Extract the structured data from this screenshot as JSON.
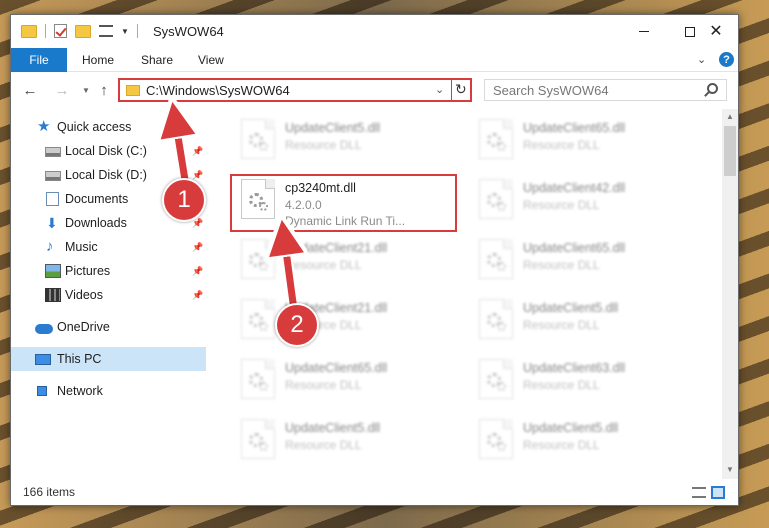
{
  "window": {
    "title": "SysWOW64"
  },
  "ribbon": {
    "tabs": [
      "File",
      "Home",
      "Share",
      "View"
    ]
  },
  "address": {
    "path": "C:\\Windows\\SysWOW64"
  },
  "search": {
    "placeholder": "Search SysWOW64"
  },
  "sidebar": {
    "items": [
      {
        "label": "Quick access",
        "icon": "star-icon"
      },
      {
        "label": "Local Disk (C:)",
        "icon": "disk-icon",
        "pinned": true
      },
      {
        "label": "Local Disk (D:)",
        "icon": "disk-icon",
        "pinned": true
      },
      {
        "label": "Documents",
        "icon": "documents-icon",
        "pinned": true
      },
      {
        "label": "Downloads",
        "icon": "download-icon",
        "pinned": true
      },
      {
        "label": "Music",
        "icon": "music-icon",
        "pinned": true
      },
      {
        "label": "Pictures",
        "icon": "pictures-icon",
        "pinned": true
      },
      {
        "label": "Videos",
        "icon": "videos-icon",
        "pinned": true
      },
      {
        "label": "OneDrive",
        "icon": "cloud-icon"
      },
      {
        "label": "This PC",
        "icon": "computer-icon",
        "selected": true
      },
      {
        "label": "Network",
        "icon": "network-icon"
      }
    ]
  },
  "files": {
    "highlighted": {
      "name": "cp3240mt.dll",
      "version": "4.2.0.0",
      "description": "Dynamic Link Run Ti..."
    },
    "left_column": [
      {
        "name": "UpdateClient5.dll",
        "type": "Resource DLL"
      },
      {
        "name": "UpdateClient21.dll",
        "type": "Resource DLL"
      },
      {
        "name": "UpdateClient21.dll",
        "type": "Resource DLL"
      },
      {
        "name": "UpdateClient65.dll",
        "type": "Resource DLL"
      },
      {
        "name": "UpdateClient5.dll",
        "type": "Resource DLL"
      }
    ],
    "right_column": [
      {
        "name": "UpdateClient65.dll",
        "type": "Resource DLL"
      },
      {
        "name": "UpdateClient42.dll",
        "type": "Resource DLL"
      },
      {
        "name": "UpdateClient65.dll",
        "type": "Resource DLL"
      },
      {
        "name": "UpdateClient5.dll",
        "type": "Resource DLL"
      },
      {
        "name": "UpdateClient63.dll",
        "type": "Resource DLL"
      },
      {
        "name": "UpdateClient5.dll",
        "type": "Resource DLL"
      }
    ]
  },
  "status": {
    "item_count": "166 items"
  },
  "annotations": {
    "step1": "1",
    "step2": "2",
    "color": "#d83b3b"
  }
}
